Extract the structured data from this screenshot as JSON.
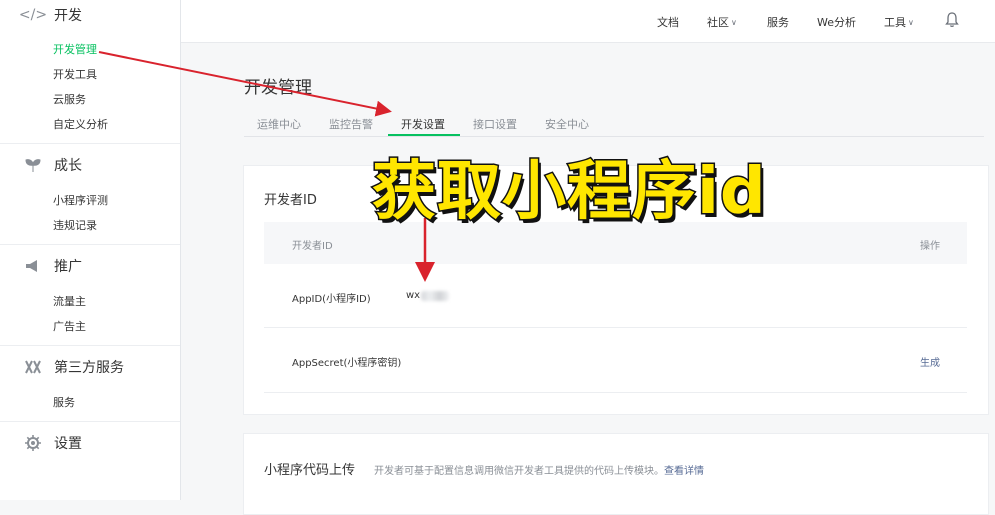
{
  "sidebar": {
    "sections": [
      {
        "label": "开发",
        "icon": "code-icon",
        "items": [
          "开发管理",
          "开发工具",
          "云服务",
          "自定义分析"
        ]
      },
      {
        "label": "成长",
        "icon": "sprout-icon",
        "items": [
          "小程序评测",
          "违规记录"
        ]
      },
      {
        "label": "推广",
        "icon": "megaphone-icon",
        "items": [
          "流量主",
          "广告主"
        ]
      },
      {
        "label": "第三方服务",
        "icon": "third-party-icon",
        "items": [
          "服务"
        ]
      },
      {
        "label": "设置",
        "icon": "gear-icon",
        "items": []
      }
    ],
    "active_item": "开发管理"
  },
  "topbar": {
    "nav": [
      "文档",
      "社区",
      "服务",
      "We分析",
      "工具"
    ],
    "bell_icon": "bell-icon"
  },
  "page": {
    "title": "开发管理",
    "tabs": [
      "运维中心",
      "监控告警",
      "开发设置",
      "接口设置",
      "安全中心"
    ],
    "active_tab": "开发设置"
  },
  "developer_id_card": {
    "title": "开发者ID",
    "headers": [
      "开发者ID",
      "操作"
    ],
    "rows": [
      {
        "label": "AppID(小程序ID)",
        "value": "wx",
        "action": ""
      },
      {
        "label": "AppSecret(小程序密钥)",
        "value": "",
        "action": "生成"
      }
    ]
  },
  "upload_card": {
    "title": "小程序代码上传",
    "description": "开发者可基于配置信息调用微信开发者工具提供的代码上传模块。",
    "link": "查看详情"
  },
  "overlay": {
    "headline": "获取小程序id"
  },
  "colors": {
    "accent_green": "#07c160",
    "link_blue": "#576b95",
    "overlay_yellow": "#ffe600",
    "arrow_red": "#d9232d"
  }
}
